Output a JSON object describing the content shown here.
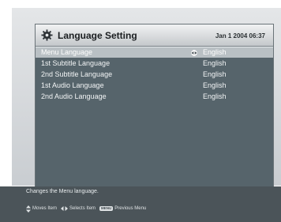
{
  "window": {
    "title": "Language Setting",
    "datetime": "Jan 1 2004 06:37",
    "icon": "gear-icon"
  },
  "menu": {
    "items": [
      {
        "label": "Menu Language",
        "value": "English",
        "selected": true
      },
      {
        "label": "1st Subtitle Language",
        "value": "English",
        "selected": false
      },
      {
        "label": "2nd Subtitle Language",
        "value": "English",
        "selected": false
      },
      {
        "label": "1st Audio Language",
        "value": "English",
        "selected": false
      },
      {
        "label": "2nd Audio Language",
        "value": "English",
        "selected": false
      }
    ]
  },
  "help": {
    "text": "Changes the Menu language.",
    "moves_item": "Moves Item",
    "selects_item": "Selects Item",
    "menu_key": "MENU",
    "previous_menu": "Previous Menu"
  },
  "colors": {
    "window_bg": "#56646b",
    "selected_row": "#b9c0c4",
    "help_bar": "#4b5459"
  }
}
